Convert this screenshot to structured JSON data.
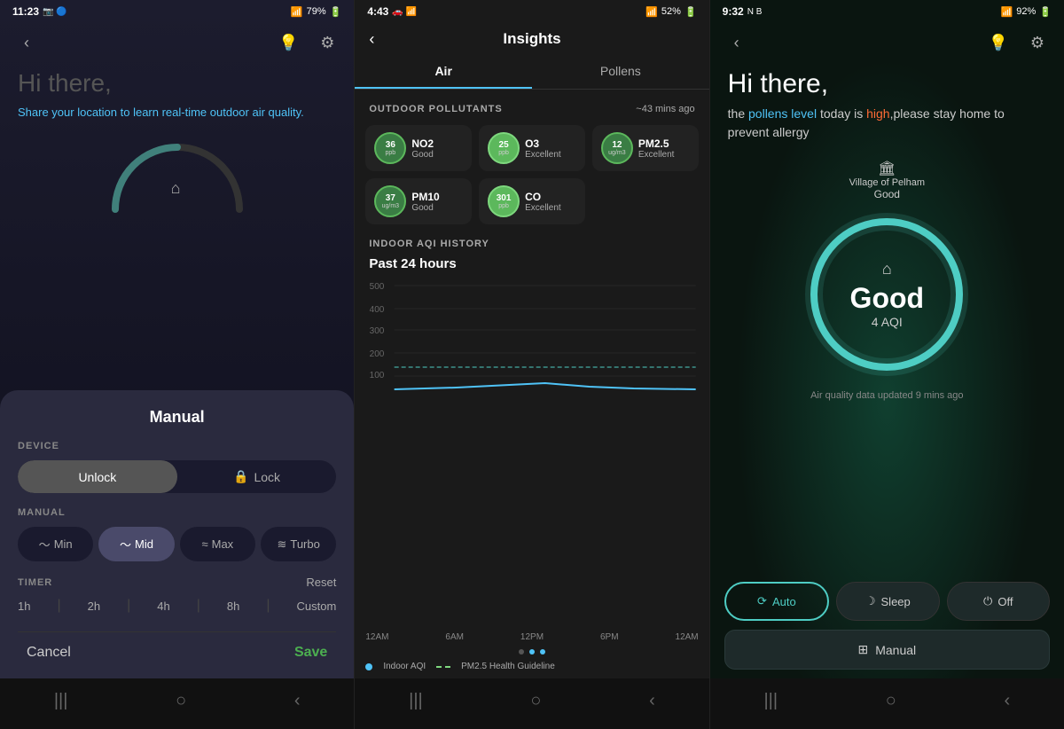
{
  "panel1": {
    "statusBar": {
      "time": "11:23",
      "battery": "79%",
      "icons": "📷 🔵 ☀"
    },
    "headerBack": "‹",
    "headerLight": "💡",
    "headerSettings": "⚙",
    "greeting": "Hi there,",
    "shareText": "Share your ",
    "shareLinkText": "location",
    "shareTextEnd": " to learn real-time outdoor air quality.",
    "bottomSheet": {
      "title": "Manual",
      "deviceLabel": "DEVICE",
      "unlockLabel": "Unlock",
      "lockLabel": "Lock",
      "manualLabel": "MANUAL",
      "fanModes": [
        {
          "id": "min",
          "label": "Min",
          "icon": "〜",
          "active": false
        },
        {
          "id": "mid",
          "label": "Mid",
          "icon": "〜",
          "active": true
        },
        {
          "id": "max",
          "label": "Max",
          "icon": "≈",
          "active": false
        },
        {
          "id": "turbo",
          "label": "Turbo",
          "icon": "≋",
          "active": false
        }
      ],
      "timerLabel": "TIMER",
      "timerReset": "Reset",
      "timerOptions": [
        "1h",
        "2h",
        "4h",
        "8h",
        "Custom"
      ],
      "cancelLabel": "Cancel",
      "saveLabel": "Save"
    }
  },
  "panel2": {
    "statusBar": {
      "time": "4:43",
      "battery": "52%"
    },
    "title": "Insights",
    "backIcon": "‹",
    "tabs": [
      {
        "id": "air",
        "label": "Air",
        "active": true
      },
      {
        "id": "pollens",
        "label": "Pollens",
        "active": false
      }
    ],
    "outdoorSection": {
      "label": "OUTDOOR POLLUTANTS",
      "timeAgo": "~43 mins ago"
    },
    "pollutants": [
      {
        "value": "36",
        "unit": "ppb",
        "name": "NO2",
        "status": "Good",
        "bright": false
      },
      {
        "value": "25",
        "unit": "ppb",
        "name": "O3",
        "status": "Excellent",
        "bright": true
      },
      {
        "value": "12",
        "unit": "ug/m3",
        "name": "PM2.5",
        "status": "Excellent",
        "bright": false
      },
      {
        "value": "37",
        "unit": "ug/m3",
        "name": "PM10",
        "status": "Good",
        "bright": false
      },
      {
        "value": "301",
        "unit": "ppb",
        "name": "CO",
        "status": "Excellent",
        "bright": true
      },
      {
        "empty": true
      }
    ],
    "indoorSection": {
      "label": "INDOOR AQI HISTORY",
      "chartTitle": "Past 24 hours"
    },
    "chartYLabels": [
      "500",
      "400",
      "300",
      "200",
      "100"
    ],
    "chartXLabels": [
      "12AM",
      "6AM",
      "12PM",
      "6PM",
      "12AM"
    ],
    "chartLegend": [
      {
        "type": "dot",
        "label": "Indoor AQI"
      },
      {
        "type": "dash",
        "label": "PM2.5 Health Guideline"
      }
    ],
    "dotNav": [
      false,
      true,
      true
    ]
  },
  "panel3": {
    "statusBar": {
      "time": "9:32",
      "battery": "92%"
    },
    "backIcon": "‹",
    "lightIcon": "💡",
    "settingsIcon": "⚙",
    "greeting": "Hi there,",
    "subtitle1": "the ",
    "pollensLabel": "pollens level",
    "subtitle2": " today is ",
    "highLabel": "high",
    "subtitle3": ",please stay home to prevent allergy",
    "locationIcon": "🏛",
    "locationName": "Village of Pelham",
    "locationStatus": "Good",
    "homeIcon": "🏠",
    "aqiStatus": "Good",
    "aqiValue": "4 AQI",
    "updateText": "Air quality data updated 9 mins ago",
    "modeBtns": [
      {
        "id": "auto",
        "label": "Auto",
        "icon": "⟳",
        "active": true
      },
      {
        "id": "sleep",
        "label": "Sleep",
        "icon": "☽",
        "active": false
      },
      {
        "id": "off",
        "label": "Off",
        "icon": "⏻",
        "active": false
      }
    ],
    "manualBtnIcon": "⊞",
    "manualBtnLabel": "Manual"
  }
}
